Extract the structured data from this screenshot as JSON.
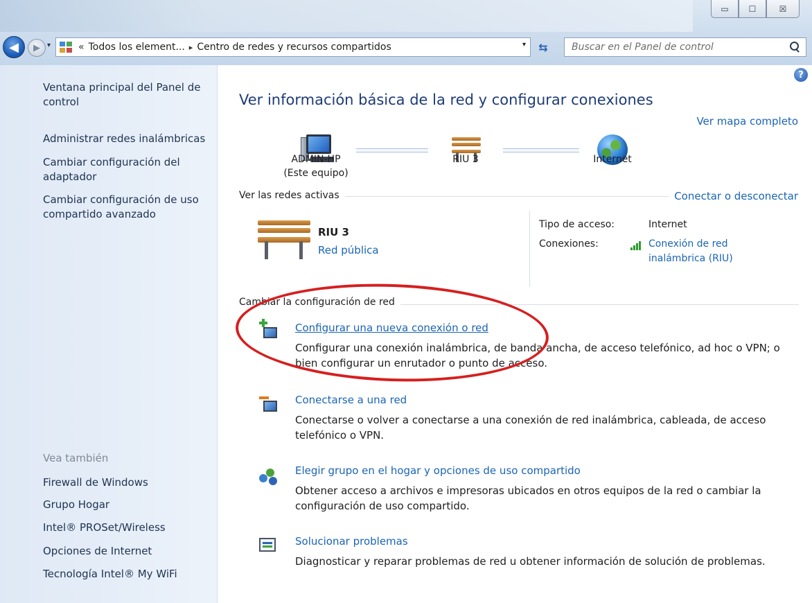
{
  "window": {
    "controls": {
      "minimize": "▭",
      "maximize": "☐",
      "close": "☒"
    }
  },
  "address_bar": {
    "chevron": "«",
    "crumb_root": "Todos los element...",
    "crumb_sep": "▸",
    "crumb_current": "Centro de redes y recursos compartidos",
    "dropdown_glyph": "▾",
    "refresh_glyph": "⇆"
  },
  "search": {
    "placeholder": "Buscar en el Panel de control"
  },
  "left_pane": {
    "links": [
      "Ventana principal del Panel de control",
      "Administrar redes inalámbricas",
      "Cambiar configuración del adaptador",
      "Cambiar configuración de uso compartido avanzado"
    ],
    "see_also_label": "Vea también",
    "see_also": [
      "Firewall de Windows",
      "Grupo Hogar",
      "Intel® PROSet/Wireless",
      "Opciones de Internet",
      "Tecnología Intel® My WiFi"
    ]
  },
  "main": {
    "help": "?",
    "title": "Ver información básica de la red y configurar conexiones",
    "map_link": "Ver mapa completo",
    "nodes": {
      "computer": "ADMIN-HP",
      "computer_sub": "(Este equipo)",
      "network": "RIU  3",
      "internet": "Internet"
    },
    "active": {
      "heading": "Ver las redes activas",
      "connect_link": "Conectar o desconectar",
      "network_name": "RIU  3",
      "network_type": "Red pública",
      "access_label": "Tipo de acceso:",
      "access_value": "Internet",
      "connections_label": "Conexiones:",
      "connection_line1": "Conexión de red",
      "connection_line2": "inalámbrica (RIU)"
    },
    "change": {
      "heading": "Cambiar la configuración de red",
      "tasks": [
        {
          "title": "Configurar una nueva conexión o red",
          "desc": "Configurar una conexión inalámbrica, de banda ancha, de acceso telefónico, ad hoc o VPN; o bien configurar un enrutador o punto de acceso."
        },
        {
          "title": "Conectarse a una red",
          "desc": "Conectarse o volver a conectarse a una conexión de red inalámbrica, cableada, de acceso telefónico o VPN."
        },
        {
          "title": "Elegir grupo en el hogar y opciones de uso compartido",
          "desc": "Obtener acceso a archivos e impresoras ubicados en otros equipos de la red o cambiar la configuración de uso compartido."
        },
        {
          "title": "Solucionar problemas",
          "desc": "Diagnosticar y reparar problemas de red u obtener información de solución de problemas."
        }
      ]
    }
  },
  "colors": {
    "link": "#1a64b6",
    "title": "#1e3c76",
    "annotation": "#d61f1f",
    "accent_green": "#2e9b2e"
  },
  "icons": {
    "pc": "computer-icon",
    "bench": "bench-network-icon",
    "globe": "globe-icon",
    "task1": "new-connection-icon",
    "task2": "connect-network-icon",
    "task3": "homegroup-icon",
    "task4": "troubleshoot-icon"
  }
}
